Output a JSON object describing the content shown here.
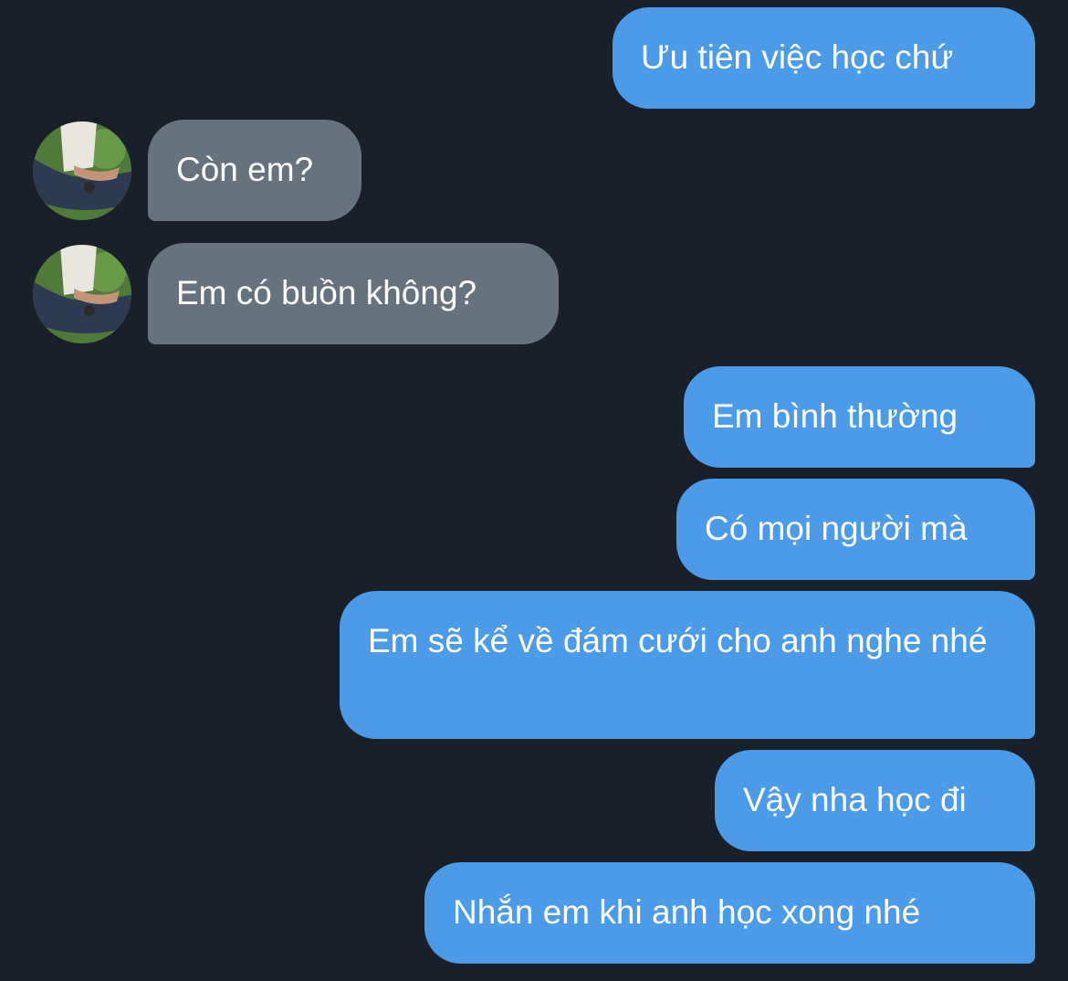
{
  "messages": [
    {
      "id": "m1",
      "direction": "outgoing",
      "text": "Ưu tiên việc học chứ"
    },
    {
      "id": "m2",
      "direction": "incoming",
      "text": "Còn em?"
    },
    {
      "id": "m3",
      "direction": "incoming",
      "text": "Em có buồn không?"
    },
    {
      "id": "m4",
      "direction": "outgoing",
      "text": "Em bình thường"
    },
    {
      "id": "m5",
      "direction": "outgoing",
      "text": "Có mọi người mà"
    },
    {
      "id": "m6",
      "direction": "outgoing",
      "text": "Em sẽ kể về đám cưới cho anh nghe nhé"
    },
    {
      "id": "m7",
      "direction": "outgoing",
      "text": "Vậy nha học đi"
    },
    {
      "id": "m8",
      "direction": "outgoing",
      "text": "Nhắn em khi anh học xong nhé"
    }
  ],
  "colors": {
    "background": "#19202a",
    "outgoing_bubble": "#4c9be8",
    "incoming_bubble": "#67727f",
    "text": "#ffffff"
  },
  "icons": {
    "avatar": "contact-avatar-photo"
  }
}
